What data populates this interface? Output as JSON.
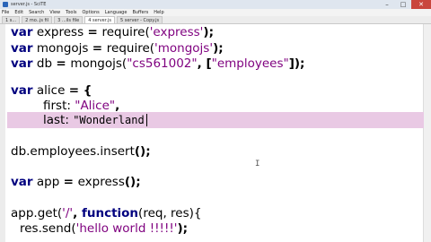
{
  "window": {
    "title": "server.js - SciTE",
    "minimize": "–",
    "maximize": "□",
    "close": "✕"
  },
  "menu": [
    "File",
    "Edit",
    "Search",
    "View",
    "Tools",
    "Options",
    "Language",
    "Buffers",
    "Help"
  ],
  "tabs": [
    {
      "label": "1 s..."
    },
    {
      "label": "2 mo..js fil"
    },
    {
      "label": "3 ...ils file"
    },
    {
      "label": "4 server.js",
      "active": true
    },
    {
      "label": "5 server - Copy.js"
    }
  ],
  "code": {
    "l1": {
      "kw": "var",
      "name": "express",
      "eq": "= ",
      "fn": "require(",
      "str": "'express'",
      "end": ");"
    },
    "l2": {
      "kw": "var",
      "name": "mongojs",
      "eq": "= ",
      "fn": "require(",
      "str": "'mongojs'",
      "end": ");"
    },
    "l3": {
      "kw": "var",
      "name": "db",
      "eq": "= ",
      "fn": "mongojs(",
      "str1": "\"cs561002\"",
      "mid": ", [",
      "str2": "\"employees\"",
      "end": "]);"
    },
    "l4": {
      "kw": "var",
      "name": "alice",
      "eq": "= {"
    },
    "l5": {
      "key": "first: ",
      "str": "\"Alice\"",
      "end": ","
    },
    "l6": {
      "key": "last: ",
      "str": "\"Wonderland"
    },
    "l7": {
      "text": "db.employees.insert",
      "end": "();"
    },
    "l8": {
      "kw": "var",
      "name": "app",
      "eq": "= ",
      "fn": "express",
      "end": "();"
    },
    "l9": {
      "a": "app.get(",
      "str": "'/'",
      "b": ", ",
      "kw": "function",
      "c": "(req, res){"
    },
    "l10": {
      "a": "res.send(",
      "str": "'hello world !!!!!'",
      "end": ");"
    }
  },
  "cursor_glyph": "I"
}
